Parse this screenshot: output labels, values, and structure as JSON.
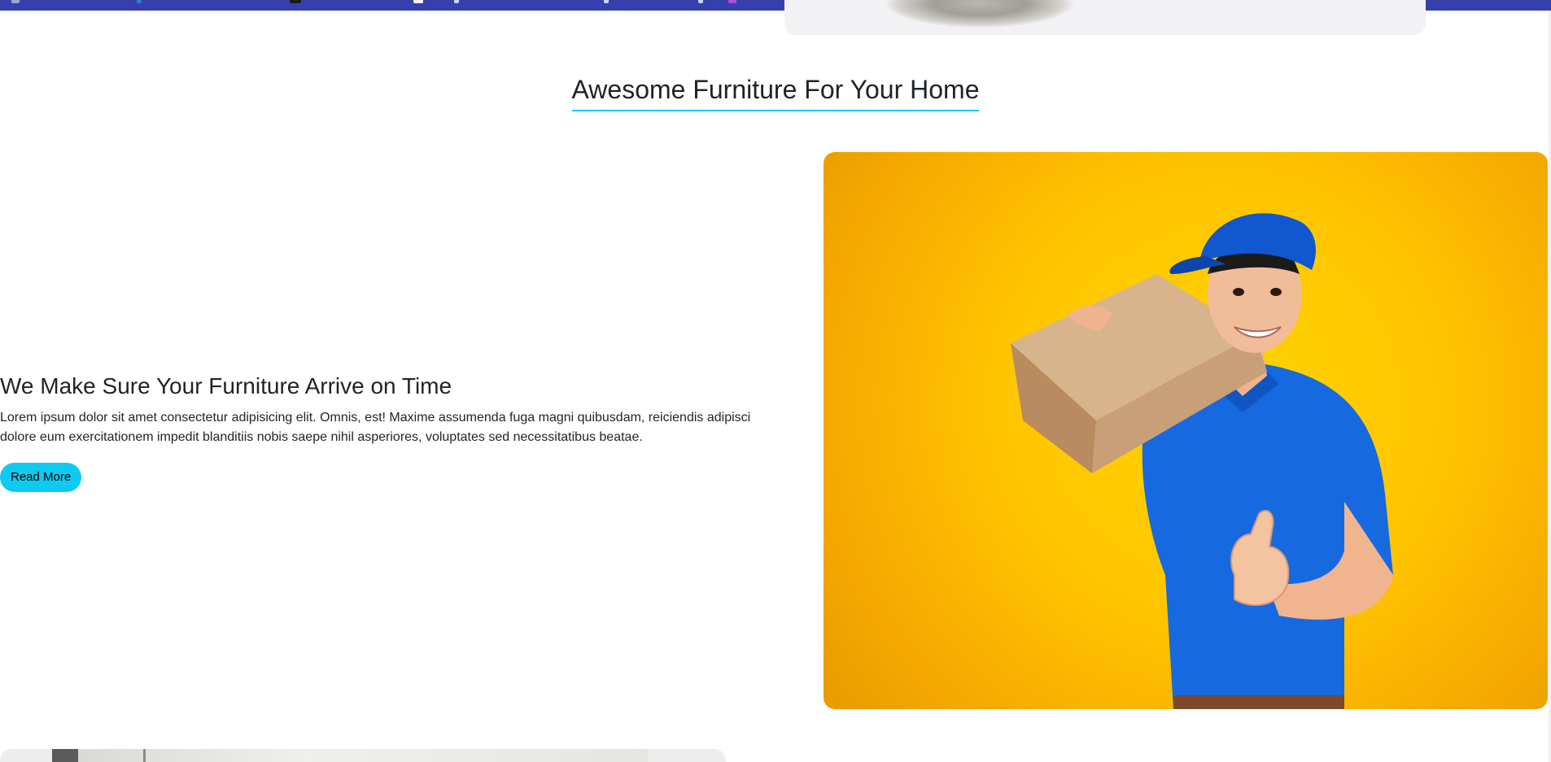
{
  "section": {
    "title": "Awesome Furniture For Your Home"
  },
  "feature": {
    "heading": "We Make Sure Your Furniture Arrive on Time",
    "body": "Lorem ipsum dolor sit amet consectetur adipisicing elit. Omnis, est! Maxime assumenda fuga magni quibusdam, reiciendis adipisci dolore eum exercitationem impedit blanditiis nobis saepe nihil asperiores, voluptates sed necessitatibus beatae.",
    "button_label": "Read More"
  },
  "colors": {
    "accent": "#0dcaf0",
    "taskbar": "#3540ad",
    "hero_background": "#ffc400"
  },
  "icons": {
    "hero_image": "delivery-man-with-box-image",
    "previous_image": "rug-image",
    "next_image": "interior-image"
  }
}
